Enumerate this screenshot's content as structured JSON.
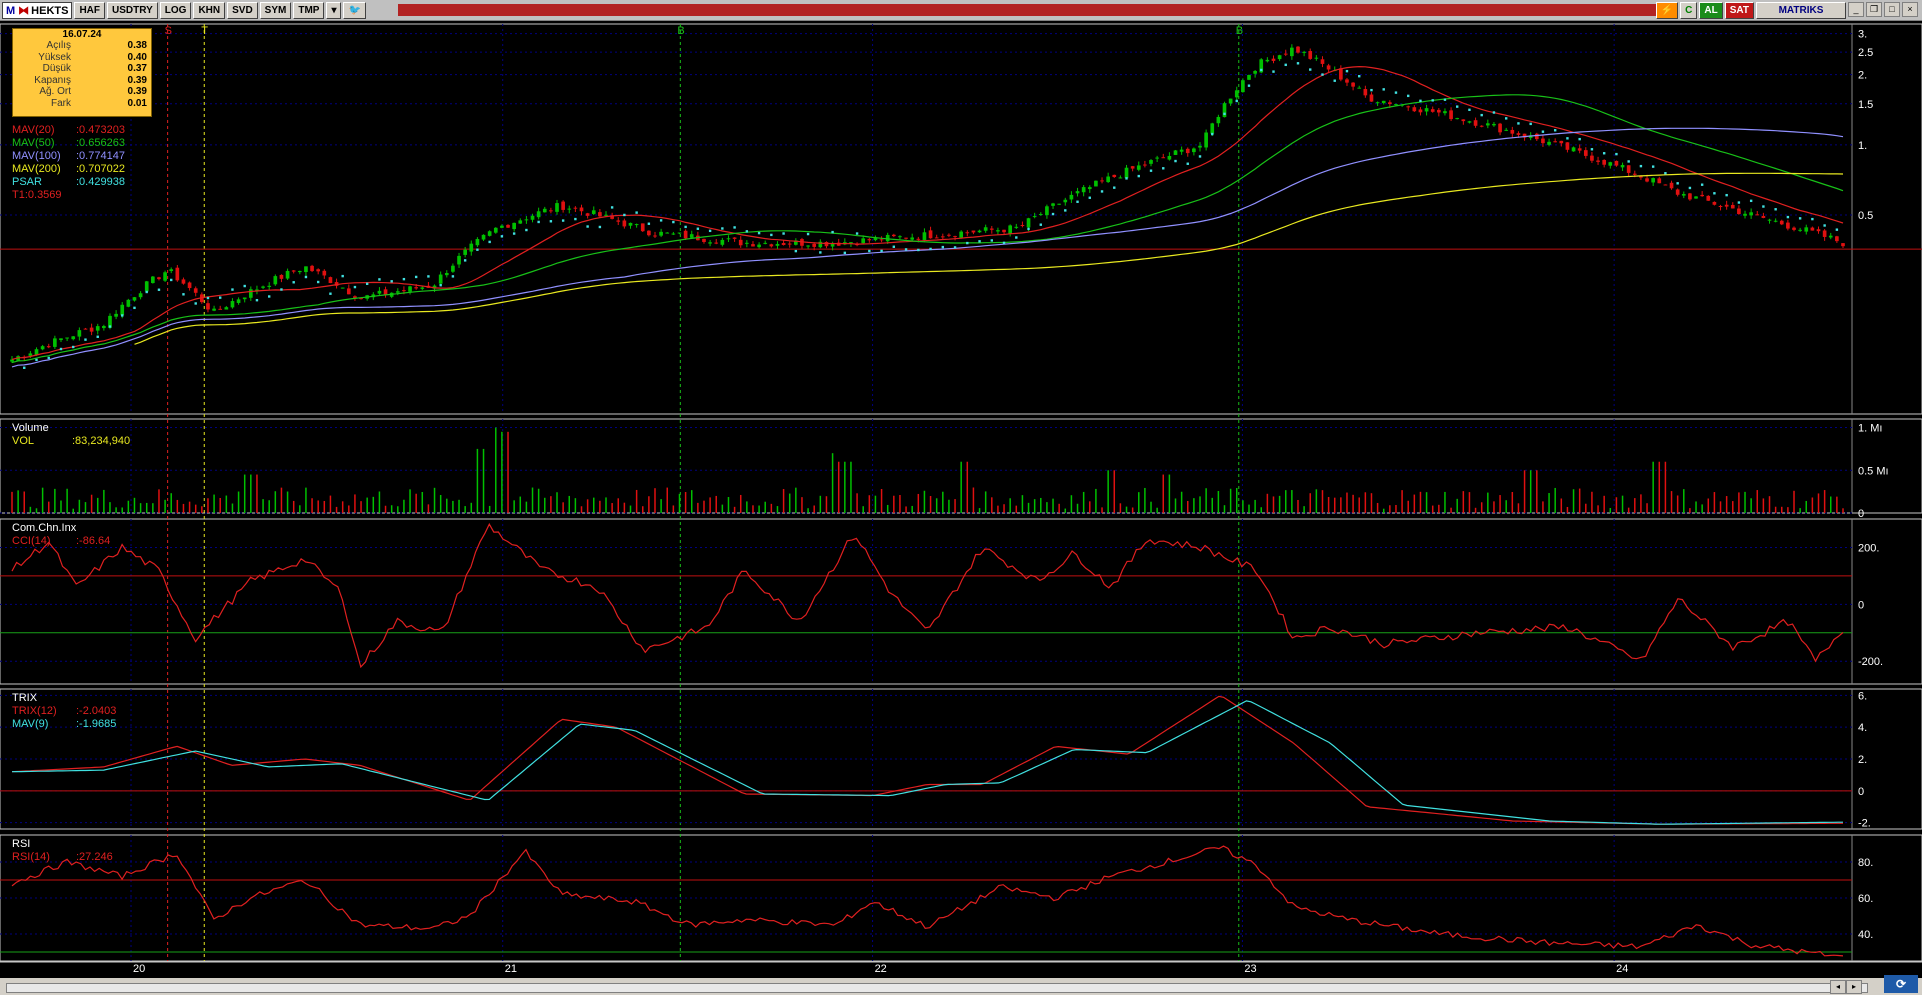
{
  "toolbar": {
    "app_icon": "M",
    "symbol": "HEKTS",
    "buttons": [
      "HAF",
      "USDTRY",
      "LOG",
      "KHN",
      "SVD",
      "SYM",
      "TMP"
    ],
    "buy_label": "AL",
    "sell_label": "SAT",
    "brand": "MATRIKS",
    "icons": [
      "twitter-icon",
      "lightning-icon",
      "refresh-icon"
    ]
  },
  "colors": {
    "background": "#000000",
    "grid": "#000080",
    "up_candle": "#00c000",
    "down_candle": "#e01010",
    "mav20": "#e02020",
    "mav50": "#18c018",
    "mav100": "#9090ff",
    "mav200": "#e8e820",
    "psar": "#40e0e0",
    "panel_border": "#c8c8c8"
  },
  "info": {
    "date": "16.07.24",
    "rows": [
      {
        "label": "Açılış",
        "value": "0.38"
      },
      {
        "label": "Yüksek",
        "value": "0.40"
      },
      {
        "label": "Düşük",
        "value": "0.37"
      },
      {
        "label": "Kapanış",
        "value": "0.39"
      },
      {
        "label": "Ağ. Ort",
        "value": "0.39"
      },
      {
        "label": "Fark",
        "value": "0.01"
      }
    ]
  },
  "chart_data": [
    {
      "type": "candlestick",
      "panel": "price",
      "legend": [
        {
          "name": "MAV(20)",
          "value": ":0.473203",
          "color": "#e02020"
        },
        {
          "name": "MAV(50)",
          "value": ":0.656263",
          "color": "#18c018"
        },
        {
          "name": "MAV(100)",
          "value": ":0.774147",
          "color": "#9090ff"
        },
        {
          "name": "MAV(200)",
          "value": ":0.707022",
          "color": "#e8e820"
        },
        {
          "name": "PSAR",
          "value": ":0.429938",
          "color": "#40e0e0"
        },
        {
          "name": "T1:0.3569",
          "value": "",
          "color": "#e02020"
        }
      ],
      "y_scale": "log",
      "y_ticks": [
        "3.",
        "2.5",
        "2.",
        "1.5",
        "1.",
        "0.5"
      ],
      "y_tick_values": [
        3,
        2.5,
        2,
        1.5,
        1,
        0.5
      ],
      "ylim": [
        0.07,
        3.3
      ],
      "horizontal_line": 0.3569,
      "x_labels": [
        "20",
        "21",
        "22",
        "23",
        "24"
      ],
      "signals": [
        {
          "label": "S",
          "color": "#e02020",
          "at": "2020-Q1"
        },
        {
          "label": "T",
          "color": "#e8e820",
          "at": "2020-Q2"
        },
        {
          "label": "B",
          "color": "#18c018",
          "at": "2021-Q3"
        },
        {
          "label": "B",
          "color": "#18c018",
          "at": "2023-Q1"
        }
      ],
      "close_anchors": [
        {
          "t": 0,
          "v": 0.12
        },
        {
          "t": 0.05,
          "v": 0.17
        },
        {
          "t": 0.085,
          "v": 0.29
        },
        {
          "t": 0.11,
          "v": 0.19
        },
        {
          "t": 0.16,
          "v": 0.3
        },
        {
          "t": 0.19,
          "v": 0.22
        },
        {
          "t": 0.23,
          "v": 0.25
        },
        {
          "t": 0.265,
          "v": 0.44
        },
        {
          "t": 0.3,
          "v": 0.55
        },
        {
          "t": 0.35,
          "v": 0.42
        },
        {
          "t": 0.4,
          "v": 0.38
        },
        {
          "t": 0.45,
          "v": 0.38
        },
        {
          "t": 0.5,
          "v": 0.41
        },
        {
          "t": 0.55,
          "v": 0.44
        },
        {
          "t": 0.6,
          "v": 0.72
        },
        {
          "t": 0.65,
          "v": 1.0
        },
        {
          "t": 0.68,
          "v": 2.2
        },
        {
          "t": 0.7,
          "v": 2.6
        },
        {
          "t": 0.74,
          "v": 1.6
        },
        {
          "t": 0.8,
          "v": 1.25
        },
        {
          "t": 0.86,
          "v": 0.9
        },
        {
          "t": 0.91,
          "v": 0.62
        },
        {
          "t": 0.95,
          "v": 0.5
        },
        {
          "t": 1.0,
          "v": 0.38
        }
      ]
    },
    {
      "type": "bar",
      "panel": "volume",
      "title": "Volume",
      "legend": [
        {
          "name": "VOL",
          "value": ":83,234,940",
          "color": "#e8e820"
        }
      ],
      "y_ticks": [
        "1. Mı",
        "0.5 Mı",
        "0"
      ],
      "y_tick_values": [
        1,
        0.5,
        0
      ],
      "ylim": [
        0,
        1.1
      ],
      "spikes": [
        {
          "t": 0.265,
          "v": 1.0
        },
        {
          "t": 0.27,
          "v": 0.95
        },
        {
          "t": 0.255,
          "v": 0.75
        },
        {
          "t": 0.45,
          "v": 0.7
        },
        {
          "t": 0.455,
          "v": 0.6
        },
        {
          "t": 0.52,
          "v": 0.6
        },
        {
          "t": 0.13,
          "v": 0.45
        },
        {
          "t": 0.6,
          "v": 0.5
        },
        {
          "t": 0.9,
          "v": 0.6
        },
        {
          "t": 0.83,
          "v": 0.5
        },
        {
          "t": 0.63,
          "v": 0.45
        }
      ]
    },
    {
      "type": "line",
      "panel": "cci",
      "title": "Com.Chn.Inx",
      "legend": [
        {
          "name": "CCI(14)",
          "value": ":-86.64",
          "color": "#e02020"
        }
      ],
      "y_ticks": [
        "200.",
        "0",
        "-200."
      ],
      "y_tick_values": [
        200,
        0,
        -200
      ],
      "ylim": [
        -280,
        300
      ],
      "ref_lines": [
        {
          "v": 100,
          "color": "#c01010"
        },
        {
          "v": -100,
          "color": "#18a018"
        }
      ],
      "anchors": [
        {
          "t": 0,
          "v": 120
        },
        {
          "t": 0.02,
          "v": 220
        },
        {
          "t": 0.035,
          "v": 60
        },
        {
          "t": 0.06,
          "v": 200
        },
        {
          "t": 0.08,
          "v": 120
        },
        {
          "t": 0.1,
          "v": -120
        },
        {
          "t": 0.13,
          "v": 80
        },
        {
          "t": 0.16,
          "v": 160
        },
        {
          "t": 0.18,
          "v": 40
        },
        {
          "t": 0.19,
          "v": -220
        },
        {
          "t": 0.21,
          "v": -60
        },
        {
          "t": 0.235,
          "v": -100
        },
        {
          "t": 0.26,
          "v": 280
        },
        {
          "t": 0.29,
          "v": 120
        },
        {
          "t": 0.32,
          "v": 60
        },
        {
          "t": 0.345,
          "v": -160
        },
        {
          "t": 0.38,
          "v": -80
        },
        {
          "t": 0.4,
          "v": 120
        },
        {
          "t": 0.43,
          "v": -60
        },
        {
          "t": 0.46,
          "v": 250
        },
        {
          "t": 0.48,
          "v": 40
        },
        {
          "t": 0.5,
          "v": -100
        },
        {
          "t": 0.53,
          "v": 200
        },
        {
          "t": 0.56,
          "v": 80
        },
        {
          "t": 0.58,
          "v": 180
        },
        {
          "t": 0.6,
          "v": 60
        },
        {
          "t": 0.62,
          "v": 230
        },
        {
          "t": 0.65,
          "v": 200
        },
        {
          "t": 0.68,
          "v": 120
        },
        {
          "t": 0.7,
          "v": -120
        },
        {
          "t": 0.72,
          "v": -80
        },
        {
          "t": 0.75,
          "v": -140
        },
        {
          "t": 0.8,
          "v": -100
        },
        {
          "t": 0.85,
          "v": -80
        },
        {
          "t": 0.89,
          "v": -200
        },
        {
          "t": 0.91,
          "v": 20
        },
        {
          "t": 0.94,
          "v": -150
        },
        {
          "t": 0.97,
          "v": -60
        },
        {
          "t": 0.985,
          "v": -200
        },
        {
          "t": 1.0,
          "v": -86
        }
      ]
    },
    {
      "type": "line",
      "panel": "trix",
      "title": "TRIX",
      "legend": [
        {
          "name": "TRIX(12)",
          "value": ":-2.0403",
          "color": "#e02020"
        },
        {
          "name": "MAV(9)",
          "value": ":-1.9685",
          "color": "#40e0e0"
        }
      ],
      "y_ticks": [
        "6.",
        "4.",
        "2.",
        "0",
        "-2."
      ],
      "y_tick_values": [
        6,
        4,
        2,
        0,
        -2
      ],
      "ylim": [
        -2.4,
        6.4
      ],
      "ref_lines": [
        {
          "v": 0,
          "color": "#c01010"
        }
      ],
      "series": [
        {
          "name": "TRIX(12)",
          "anchors": [
            {
              "t": 0,
              "v": 1.2
            },
            {
              "t": 0.05,
              "v": 1.5
            },
            {
              "t": 0.09,
              "v": 2.8
            },
            {
              "t": 0.12,
              "v": 1.6
            },
            {
              "t": 0.16,
              "v": 2.0
            },
            {
              "t": 0.19,
              "v": 1.6
            },
            {
              "t": 0.25,
              "v": -0.6
            },
            {
              "t": 0.3,
              "v": 4.5
            },
            {
              "t": 0.33,
              "v": 4.0
            },
            {
              "t": 0.4,
              "v": -0.2
            },
            {
              "t": 0.47,
              "v": -0.3
            },
            {
              "t": 0.5,
              "v": 0.4
            },
            {
              "t": 0.53,
              "v": 0.4
            },
            {
              "t": 0.57,
              "v": 2.8
            },
            {
              "t": 0.61,
              "v": 2.3
            },
            {
              "t": 0.66,
              "v": 6.0
            },
            {
              "t": 0.7,
              "v": 3.0
            },
            {
              "t": 0.74,
              "v": -1.0
            },
            {
              "t": 0.82,
              "v": -1.9
            },
            {
              "t": 0.9,
              "v": -2.1
            },
            {
              "t": 1.0,
              "v": -2.04
            }
          ]
        },
        {
          "name": "MAV(9)",
          "anchors": [
            {
              "t": 0,
              "v": 1.2
            },
            {
              "t": 0.05,
              "v": 1.3
            },
            {
              "t": 0.1,
              "v": 2.5
            },
            {
              "t": 0.14,
              "v": 1.5
            },
            {
              "t": 0.18,
              "v": 1.7
            },
            {
              "t": 0.26,
              "v": -0.6
            },
            {
              "t": 0.31,
              "v": 4.2
            },
            {
              "t": 0.34,
              "v": 3.8
            },
            {
              "t": 0.41,
              "v": -0.2
            },
            {
              "t": 0.48,
              "v": -0.3
            },
            {
              "t": 0.51,
              "v": 0.4
            },
            {
              "t": 0.54,
              "v": 0.5
            },
            {
              "t": 0.58,
              "v": 2.6
            },
            {
              "t": 0.62,
              "v": 2.4
            },
            {
              "t": 0.675,
              "v": 5.7
            },
            {
              "t": 0.72,
              "v": 3.0
            },
            {
              "t": 0.76,
              "v": -0.9
            },
            {
              "t": 0.84,
              "v": -1.9
            },
            {
              "t": 0.9,
              "v": -2.1
            },
            {
              "t": 1.0,
              "v": -1.97
            }
          ]
        }
      ]
    },
    {
      "type": "line",
      "panel": "rsi",
      "title": "RSI",
      "legend": [
        {
          "name": "RSI(14)",
          "value": ":27.246",
          "color": "#e02020"
        }
      ],
      "y_ticks": [
        "80.",
        "60.",
        "40."
      ],
      "y_tick_values": [
        80,
        60,
        40
      ],
      "ylim": [
        25,
        95
      ],
      "ref_lines": [
        {
          "v": 70,
          "color": "#c01010"
        },
        {
          "v": 30,
          "color": "#18a018"
        }
      ],
      "anchors": [
        {
          "t": 0,
          "v": 68
        },
        {
          "t": 0.03,
          "v": 80
        },
        {
          "t": 0.06,
          "v": 72
        },
        {
          "t": 0.09,
          "v": 85
        },
        {
          "t": 0.11,
          "v": 48
        },
        {
          "t": 0.13,
          "v": 60
        },
        {
          "t": 0.16,
          "v": 70
        },
        {
          "t": 0.19,
          "v": 45
        },
        {
          "t": 0.23,
          "v": 43
        },
        {
          "t": 0.25,
          "v": 50
        },
        {
          "t": 0.28,
          "v": 86
        },
        {
          "t": 0.3,
          "v": 62
        },
        {
          "t": 0.34,
          "v": 58
        },
        {
          "t": 0.37,
          "v": 45
        },
        {
          "t": 0.4,
          "v": 48
        },
        {
          "t": 0.45,
          "v": 45
        },
        {
          "t": 0.47,
          "v": 58
        },
        {
          "t": 0.5,
          "v": 44
        },
        {
          "t": 0.54,
          "v": 66
        },
        {
          "t": 0.57,
          "v": 60
        },
        {
          "t": 0.6,
          "v": 72
        },
        {
          "t": 0.63,
          "v": 80
        },
        {
          "t": 0.66,
          "v": 88
        },
        {
          "t": 0.68,
          "v": 78
        },
        {
          "t": 0.7,
          "v": 55
        },
        {
          "t": 0.73,
          "v": 48
        },
        {
          "t": 0.78,
          "v": 40
        },
        {
          "t": 0.84,
          "v": 35
        },
        {
          "t": 0.89,
          "v": 33
        },
        {
          "t": 0.92,
          "v": 45
        },
        {
          "t": 0.95,
          "v": 34
        },
        {
          "t": 1.0,
          "v": 27
        }
      ]
    }
  ]
}
